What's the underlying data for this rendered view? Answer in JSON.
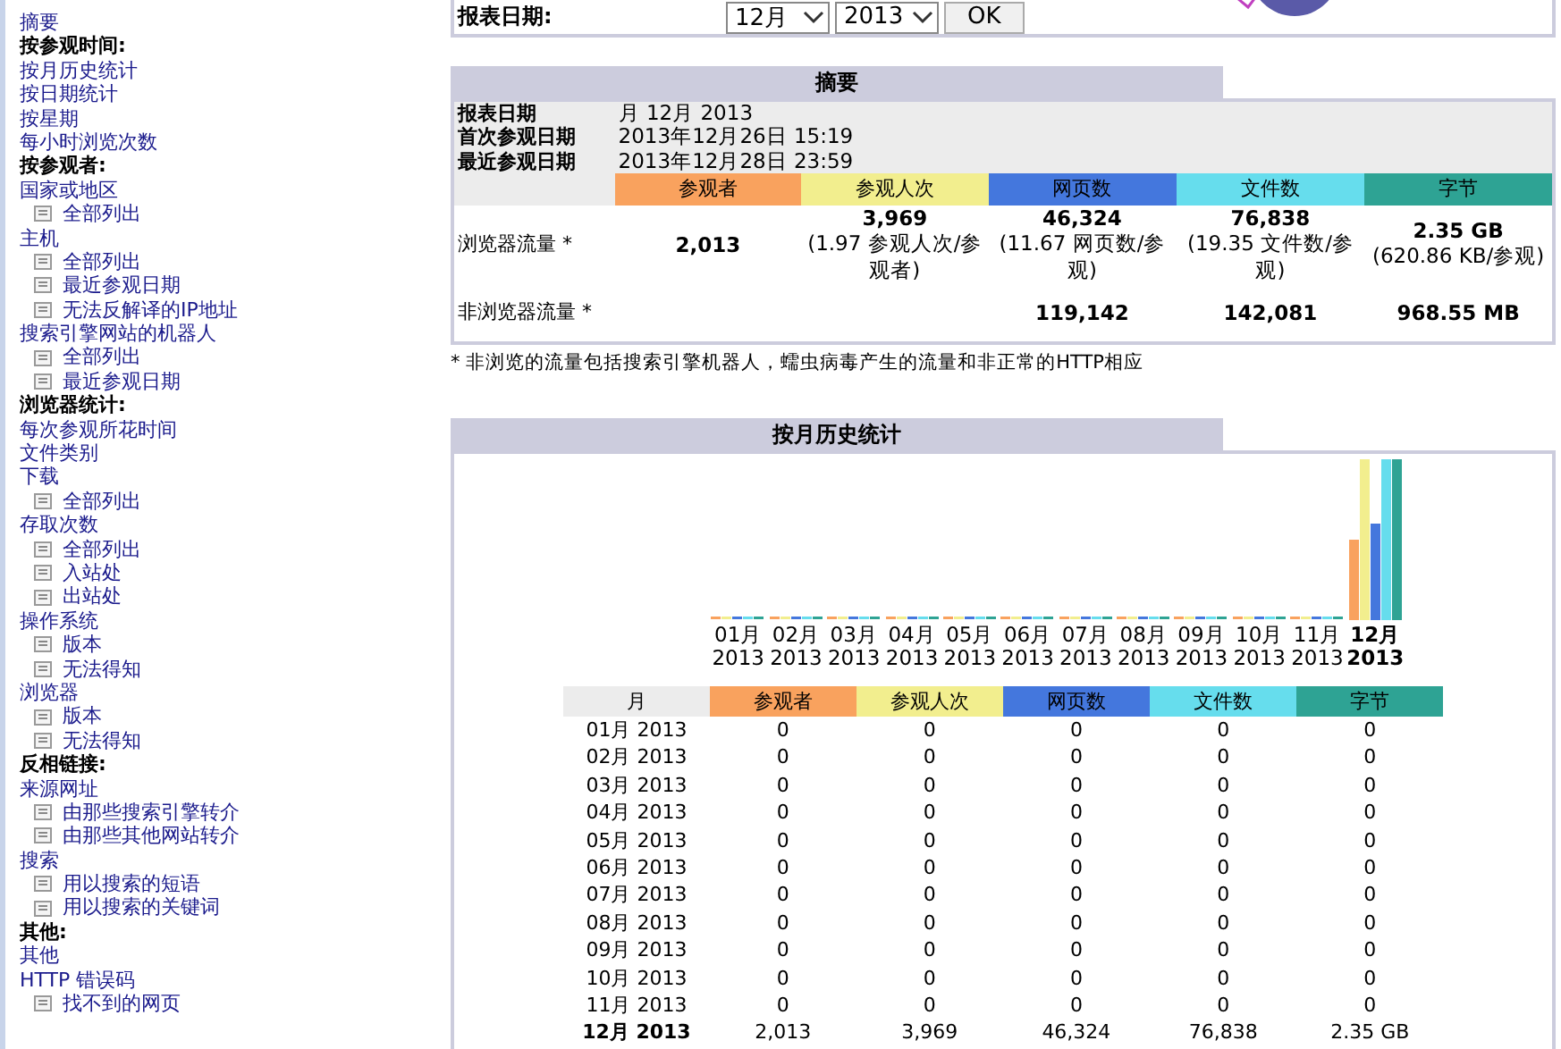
{
  "sidebar": {
    "items": [
      {
        "kind": "link",
        "label": "摘要"
      },
      {
        "kind": "header",
        "label": "按参观时间:"
      },
      {
        "kind": "link",
        "label": "按月历史统计"
      },
      {
        "kind": "link",
        "label": "按日期统计"
      },
      {
        "kind": "link",
        "label": "按星期"
      },
      {
        "kind": "link",
        "label": "每小时浏览次数"
      },
      {
        "kind": "header",
        "label": "按参观者:"
      },
      {
        "kind": "link",
        "label": "国家或地区"
      },
      {
        "kind": "sub",
        "label": "全部列出"
      },
      {
        "kind": "link",
        "label": "主机"
      },
      {
        "kind": "sub",
        "label": "全部列出"
      },
      {
        "kind": "sub",
        "label": "最近参观日期"
      },
      {
        "kind": "sub",
        "label": "无法反解译的IP地址"
      },
      {
        "kind": "link",
        "label": "搜索引擎网站的机器人"
      },
      {
        "kind": "sub",
        "label": "全部列出"
      },
      {
        "kind": "sub",
        "label": "最近参观日期"
      },
      {
        "kind": "header",
        "label": "浏览器统计:"
      },
      {
        "kind": "link",
        "label": "每次参观所花时间"
      },
      {
        "kind": "link",
        "label": "文件类别"
      },
      {
        "kind": "link",
        "label": "下载"
      },
      {
        "kind": "sub",
        "label": "全部列出"
      },
      {
        "kind": "link",
        "label": "存取次数"
      },
      {
        "kind": "sub",
        "label": "全部列出"
      },
      {
        "kind": "sub",
        "label": "入站处"
      },
      {
        "kind": "sub",
        "label": "出站处"
      },
      {
        "kind": "link",
        "label": "操作系统"
      },
      {
        "kind": "sub",
        "label": "版本"
      },
      {
        "kind": "sub",
        "label": "无法得知"
      },
      {
        "kind": "link",
        "label": "浏览器"
      },
      {
        "kind": "sub",
        "label": "版本"
      },
      {
        "kind": "sub",
        "label": "无法得知"
      },
      {
        "kind": "header",
        "label": "反相链接:"
      },
      {
        "kind": "link",
        "label": "来源网址"
      },
      {
        "kind": "sub",
        "label": "由那些搜索引擎转介"
      },
      {
        "kind": "sub",
        "label": "由那些其他网站转介"
      },
      {
        "kind": "link",
        "label": "搜索"
      },
      {
        "kind": "sub",
        "label": "用以搜索的短语"
      },
      {
        "kind": "sub",
        "label": "用以搜索的关键词"
      },
      {
        "kind": "header",
        "label": "其他:"
      },
      {
        "kind": "link",
        "label": "其他"
      },
      {
        "kind": "link",
        "label": "HTTP 错误码"
      },
      {
        "kind": "sub",
        "label": "找不到的网页"
      }
    ]
  },
  "report_form": {
    "label": "报表日期:",
    "month": "12月",
    "year": "2013",
    "ok_button": "OK"
  },
  "summary": {
    "title": "摘要",
    "info": [
      {
        "label": "报表日期",
        "value": "月 12月 2013"
      },
      {
        "label": "首次参观日期",
        "value": "2013年12月26日 15:19"
      },
      {
        "label": "最近参观日期",
        "value": "2013年12月28日 23:59"
      }
    ],
    "columns": [
      {
        "label": "参观者",
        "color": "#f9a25e"
      },
      {
        "label": "参观人次",
        "color": "#f2ee8e"
      },
      {
        "label": "网页数",
        "color": "#4477dd"
      },
      {
        "label": "文件数",
        "color": "#66dded"
      },
      {
        "label": "字节",
        "color": "#2ea394"
      }
    ],
    "rows": [
      {
        "label": "浏览器流量 *",
        "cells": [
          {
            "value": "2,013"
          },
          {
            "value": "3,969",
            "note": "(1.97 参观人次/参观者)"
          },
          {
            "value": "46,324",
            "note": "(11.67 网页数/参观)"
          },
          {
            "value": "76,838",
            "note": "(19.35 文件数/参观)"
          },
          {
            "value": "2.35 GB",
            "note": "(620.86 KB/参观)"
          }
        ]
      },
      {
        "label": "非浏览器流量 *",
        "cells": [
          null,
          null,
          {
            "value": "119,142"
          },
          {
            "value": "142,081"
          },
          {
            "value": "968.55 MB"
          }
        ]
      }
    ],
    "footnote": "* 非浏览的流量包括搜索引擎机器人，蠕虫病毒产生的流量和非正常的HTTP相应"
  },
  "monthly": {
    "title": "按月历史统计",
    "months": [
      {
        "month": "01月",
        "year": "2013",
        "selected": false
      },
      {
        "month": "02月",
        "year": "2013",
        "selected": false
      },
      {
        "month": "03月",
        "year": "2013",
        "selected": false
      },
      {
        "month": "04月",
        "year": "2013",
        "selected": false
      },
      {
        "month": "05月",
        "year": "2013",
        "selected": false
      },
      {
        "month": "06月",
        "year": "2013",
        "selected": false
      },
      {
        "month": "07月",
        "year": "2013",
        "selected": false
      },
      {
        "month": "08月",
        "year": "2013",
        "selected": false
      },
      {
        "month": "09月",
        "year": "2013",
        "selected": false
      },
      {
        "month": "10月",
        "year": "2013",
        "selected": false
      },
      {
        "month": "11月",
        "year": "2013",
        "selected": false
      },
      {
        "month": "12月",
        "year": "2013",
        "selected": true
      }
    ],
    "month_column": "月",
    "columns": [
      {
        "label": "参观者",
        "color": "#f9a25e"
      },
      {
        "label": "参观人次",
        "color": "#f2ee8e"
      },
      {
        "label": "网页数",
        "color": "#4477dd"
      },
      {
        "label": "文件数",
        "color": "#66dded"
      },
      {
        "label": "字节",
        "color": "#2ea394"
      }
    ],
    "rows": [
      {
        "month": "01月 2013",
        "selected": false,
        "cells": [
          "0",
          "0",
          "0",
          "0",
          "0"
        ]
      },
      {
        "month": "02月 2013",
        "selected": false,
        "cells": [
          "0",
          "0",
          "0",
          "0",
          "0"
        ]
      },
      {
        "month": "03月 2013",
        "selected": false,
        "cells": [
          "0",
          "0",
          "0",
          "0",
          "0"
        ]
      },
      {
        "month": "04月 2013",
        "selected": false,
        "cells": [
          "0",
          "0",
          "0",
          "0",
          "0"
        ]
      },
      {
        "month": "05月 2013",
        "selected": false,
        "cells": [
          "0",
          "0",
          "0",
          "0",
          "0"
        ]
      },
      {
        "month": "06月 2013",
        "selected": false,
        "cells": [
          "0",
          "0",
          "0",
          "0",
          "0"
        ]
      },
      {
        "month": "07月 2013",
        "selected": false,
        "cells": [
          "0",
          "0",
          "0",
          "0",
          "0"
        ]
      },
      {
        "month": "08月 2013",
        "selected": false,
        "cells": [
          "0",
          "0",
          "0",
          "0",
          "0"
        ]
      },
      {
        "month": "09月 2013",
        "selected": false,
        "cells": [
          "0",
          "0",
          "0",
          "0",
          "0"
        ]
      },
      {
        "month": "10月 2013",
        "selected": false,
        "cells": [
          "0",
          "0",
          "0",
          "0",
          "0"
        ]
      },
      {
        "month": "11月 2013",
        "selected": false,
        "cells": [
          "0",
          "0",
          "0",
          "0",
          "0"
        ]
      },
      {
        "month": "12月 2013",
        "selected": true,
        "cells": [
          "2,013",
          "3,969",
          "46,324",
          "76,838",
          "2.35 GB"
        ]
      }
    ]
  }
}
